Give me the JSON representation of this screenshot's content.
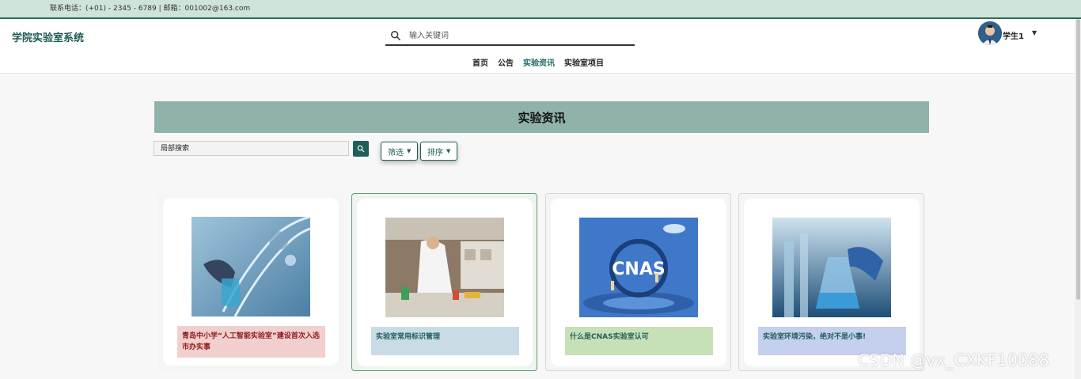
{
  "topbar": {
    "contact": "联系电话：(+01) - 2345 - 6789 | 邮箱：001002@163.com"
  },
  "header": {
    "brand": "学院实验室系统",
    "search_placeholder": "输入关键词",
    "nav": [
      {
        "label": "首页",
        "active": false
      },
      {
        "label": "公告",
        "active": false
      },
      {
        "label": "实验资讯",
        "active": true
      },
      {
        "label": "实验室项目",
        "active": false
      }
    ],
    "user": {
      "name": "学生1"
    }
  },
  "main": {
    "title": "实验资讯",
    "local_search_placeholder": "局部搜索",
    "filter_label": "筛选",
    "sort_label": "排序",
    "cards": [
      {
        "title": "青岛中小学“人工智能实验室”建设首次入选市办实事"
      },
      {
        "title": "实验室常用标识管理"
      },
      {
        "title": "什么是CNAS实验室认可"
      },
      {
        "title": "实验室环境污染，绝对不是小事!"
      }
    ]
  },
  "watermark": "CSDN @vx_CXKF10088",
  "colors": {
    "accent": "#1f5f5a",
    "banner": "#8fb3aa",
    "topbar": "#cfe4d8"
  },
  "icons": {
    "search": "search-icon",
    "caret": "caret-down-icon"
  }
}
